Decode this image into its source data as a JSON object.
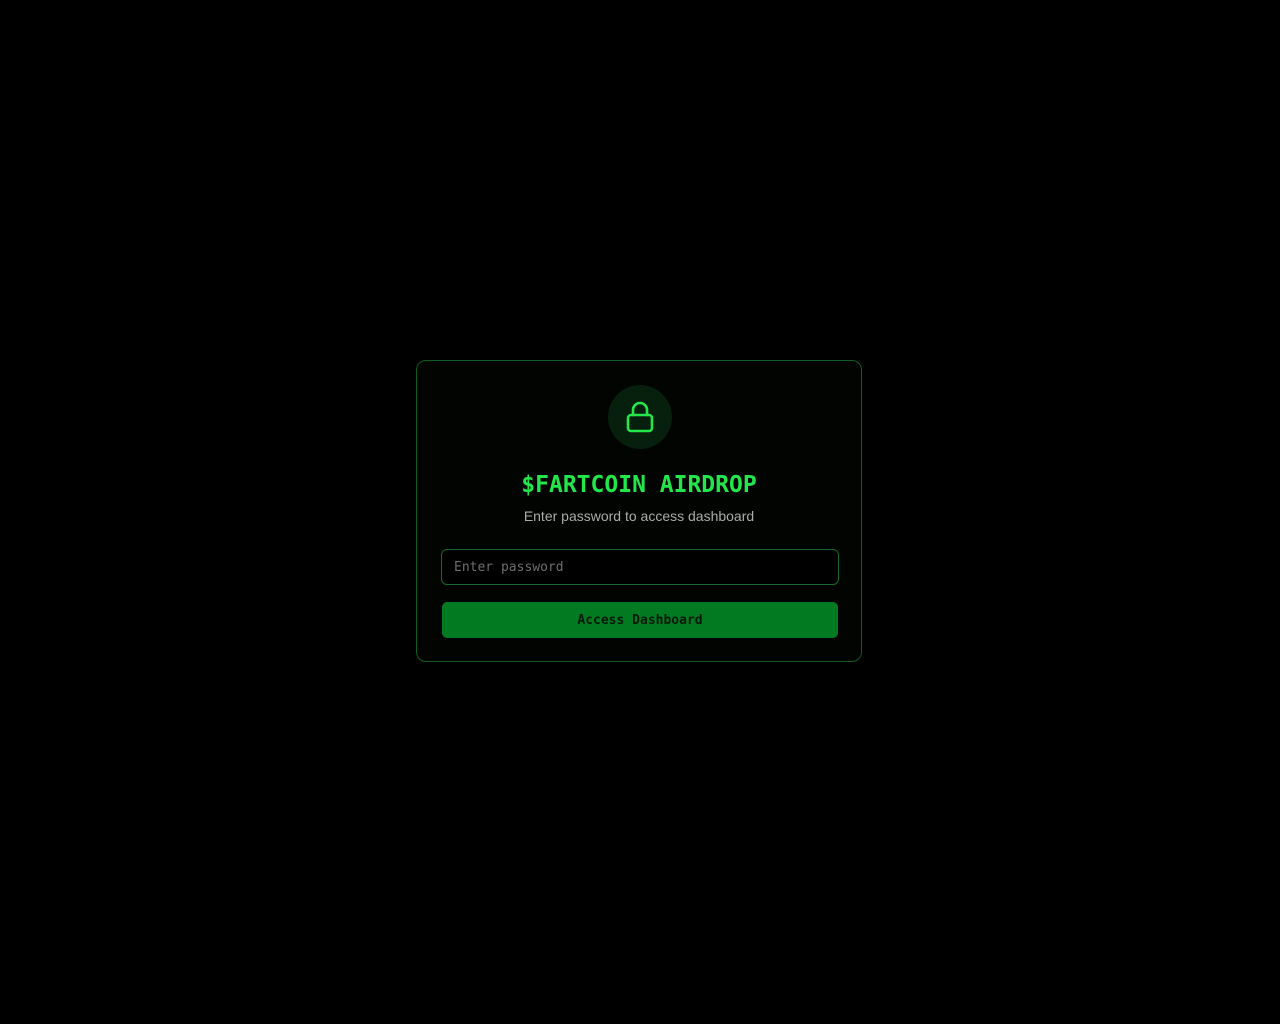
{
  "login": {
    "title": "$FARTCOIN AIRDROP",
    "subtitle": "Enter password to access dashboard",
    "password_placeholder": "Enter password",
    "password_value": "",
    "submit_label": "Access Dashboard",
    "icon": "lock-icon"
  },
  "colors": {
    "background": "#000000",
    "accent": "#22e64a",
    "button": "#027a22",
    "border": "#0f5c1f"
  }
}
